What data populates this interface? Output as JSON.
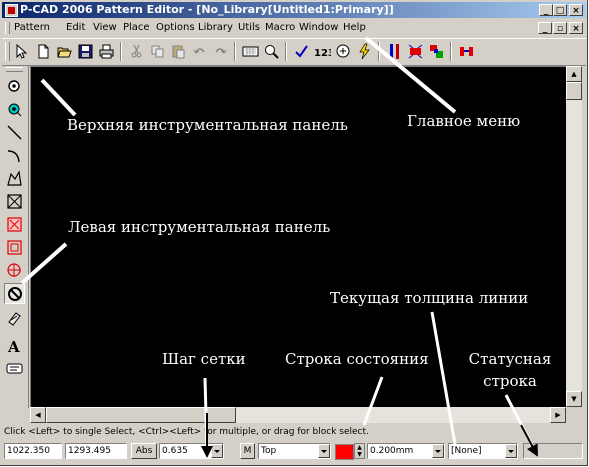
{
  "window": {
    "title": "P-CAD 2006 Pattern Editor - [No_Library[Untitled1:Primary]]"
  },
  "menu": [
    "Pattern",
    "Edit",
    "View",
    "Place",
    "Options",
    "Library",
    "Utils",
    "Macro",
    "Window",
    "Help"
  ],
  "toolbar_top": {
    "icons": [
      "select-arrow-icon",
      "new-file-icon",
      "open-folder-icon",
      "save-disk-icon",
      "print-icon",
      "cut-icon",
      "copy-icon",
      "paste-icon",
      "undo-icon",
      "redo-icon",
      "zoom-window-icon",
      "zoom-icon",
      "check-icon",
      "renumber-icon",
      "query-icon",
      "lightning-icon",
      "pad-array-1-icon",
      "pad-array-2-icon",
      "pad-array-3-icon",
      "pad-array-4-icon"
    ],
    "renumber_label": "123"
  },
  "toolbar_left": {
    "icons": [
      "place-pad-icon",
      "place-via-icon",
      "place-line-icon",
      "place-arc-icon",
      "place-polygon-icon",
      "place-keepout-icon",
      "place-fill-icon",
      "place-copper-pour-icon",
      "place-cutout-icon",
      "place-plane-icon",
      "place-point-icon",
      "place-text-icon",
      "place-attribute-icon"
    ],
    "text_tool_label": "A"
  },
  "status": {
    "hint": "Click <Left> to single Select, <Ctrl><Left> for multiple, or drag for block select.",
    "x": "1022.350",
    "y": "1293.495",
    "abs_label": "Abs",
    "grid": "0.635",
    "m_label": "M",
    "layer": "Top",
    "layer_color": "#ff0000",
    "line_width": "0.200mm",
    "pad_style": "[None]"
  },
  "annotations": {
    "top_toolbar": "Верхняя инструментальная панель",
    "main_menu": "Главное меню",
    "left_toolbar": "Левая инструментальная панель",
    "line_width": "Текущая толщина линии",
    "grid_step": "Шаг сетки",
    "status_line": "Строка состояния",
    "status_row_1": "Статусная",
    "status_row_2": "строка"
  }
}
